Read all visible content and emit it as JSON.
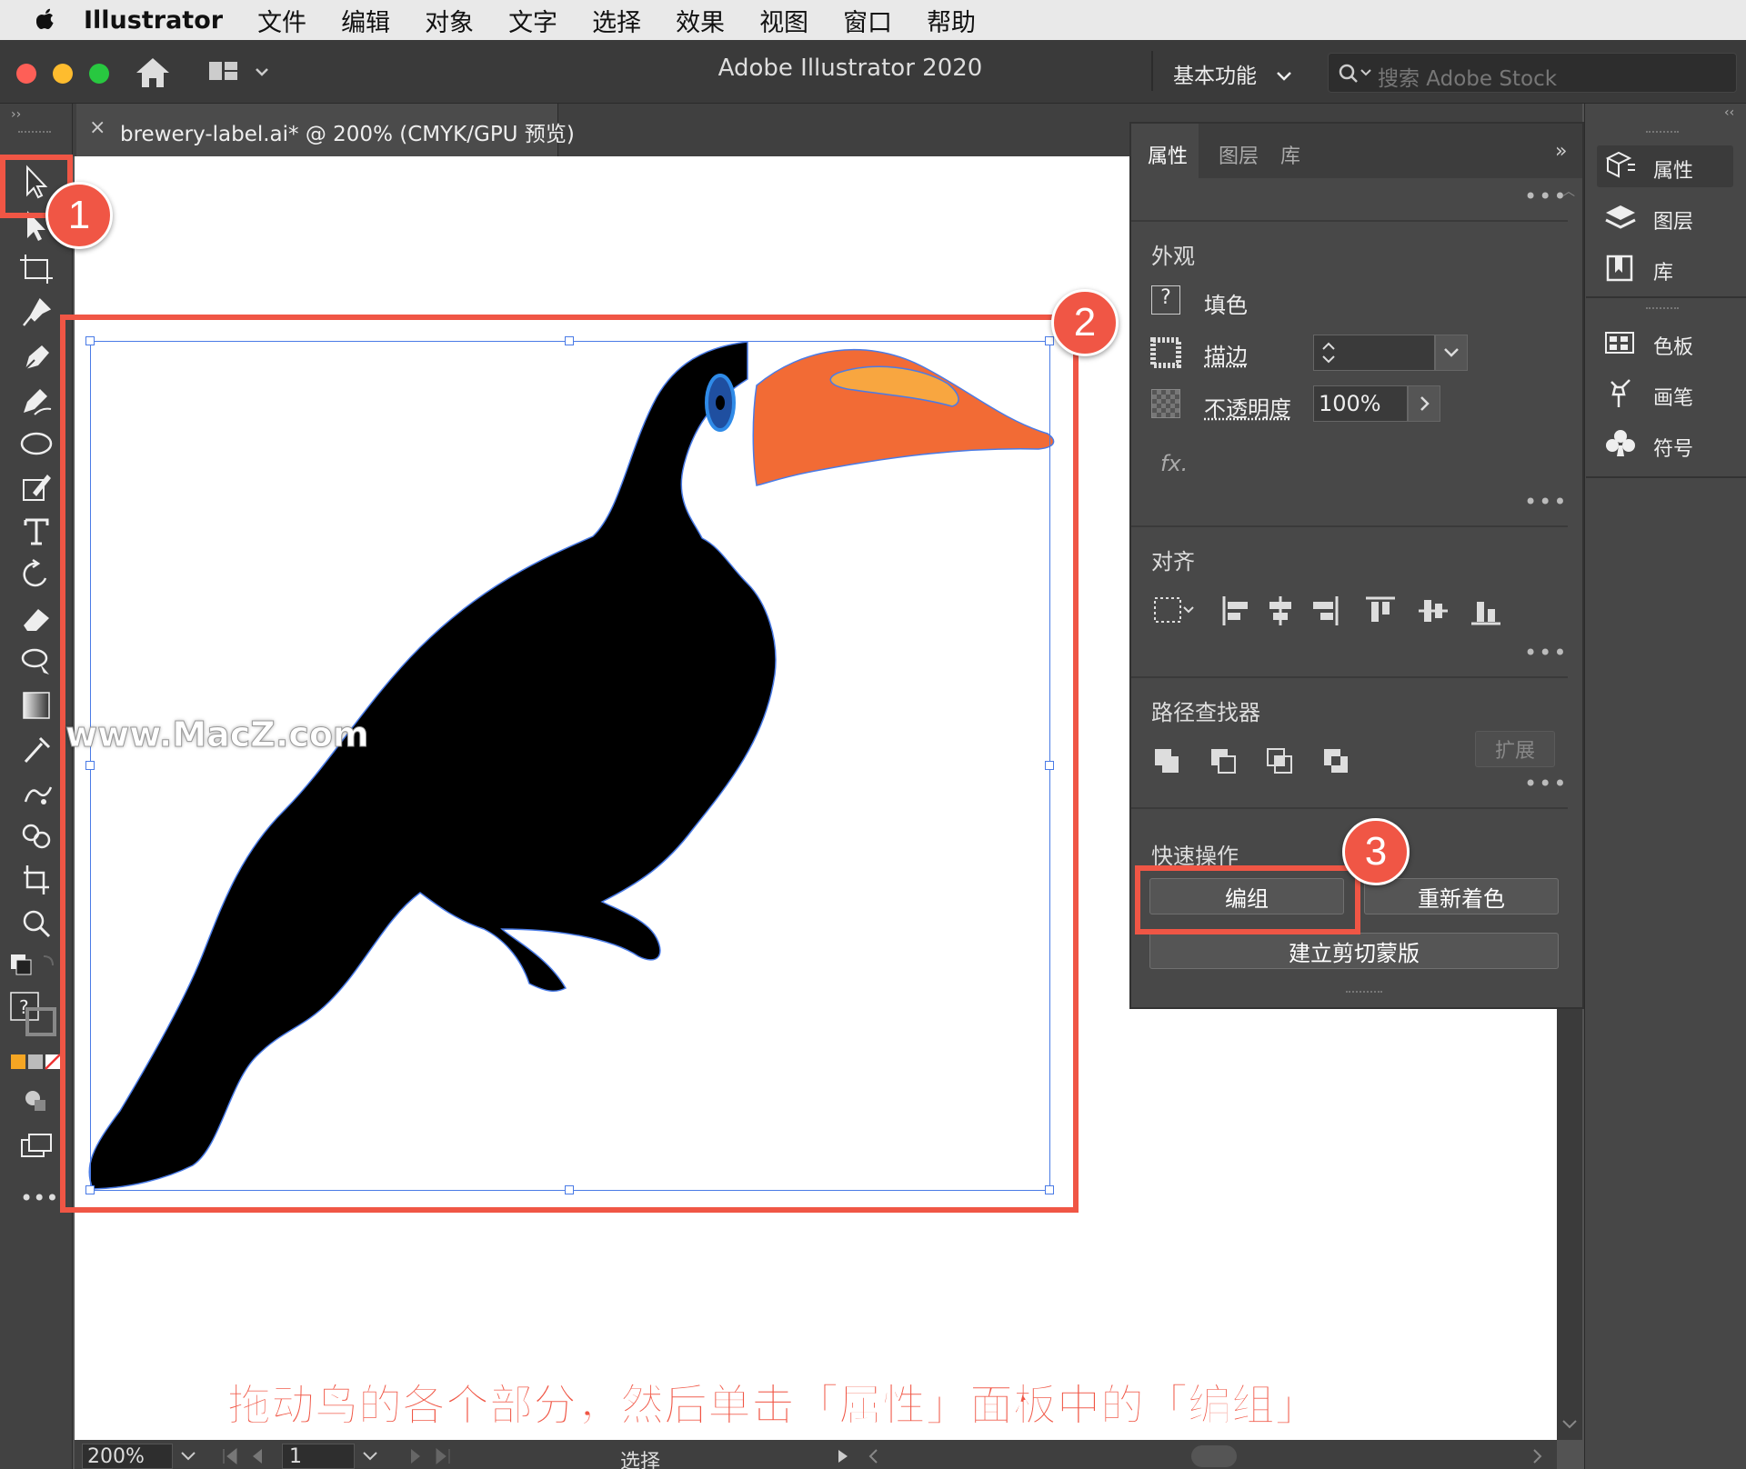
{
  "menubar": {
    "app": "Illustrator",
    "items": [
      "文件",
      "编辑",
      "对象",
      "文字",
      "选择",
      "效果",
      "视图",
      "窗口",
      "帮助"
    ]
  },
  "window": {
    "title": "Adobe Illustrator 2020",
    "workspace": "基本功能",
    "search_placeholder": "搜索 Adobe Stock"
  },
  "document_tab": {
    "close": "×",
    "title": "brewery-label.ai* @ 200% (CMYK/GPU 预览)"
  },
  "panel": {
    "tabs": [
      "属性",
      "图层",
      "库"
    ],
    "appearance": {
      "title": "外观",
      "fill_label": "填色",
      "stroke_label": "描边",
      "opacity_label": "不透明度",
      "opacity_value": "100%",
      "fx": "fx."
    },
    "align": {
      "title": "对齐"
    },
    "pathfinder": {
      "title": "路径查找器",
      "expand": "扩展"
    },
    "quick_actions": {
      "title": "快速操作",
      "group": "编组",
      "recolor": "重新着色",
      "clipping_mask": "建立剪切蒙版"
    }
  },
  "right_dock": [
    "属性",
    "图层",
    "库",
    "色板",
    "画笔",
    "符号"
  ],
  "status": {
    "zoom": "200%",
    "page": "1",
    "tool": "选择"
  },
  "annotations": {
    "badge1": "1",
    "badge2": "2",
    "badge3": "3",
    "caption": "拖动鸟的各个部分，然后单击「属性」面板中的「编组」",
    "watermark": "www.MacZ.com"
  },
  "colors": {
    "annotation_red": "#f05645",
    "beak_orange": "#f26b35",
    "beak_highlight": "#f8a640",
    "selection_blue": "#4a7be6"
  }
}
